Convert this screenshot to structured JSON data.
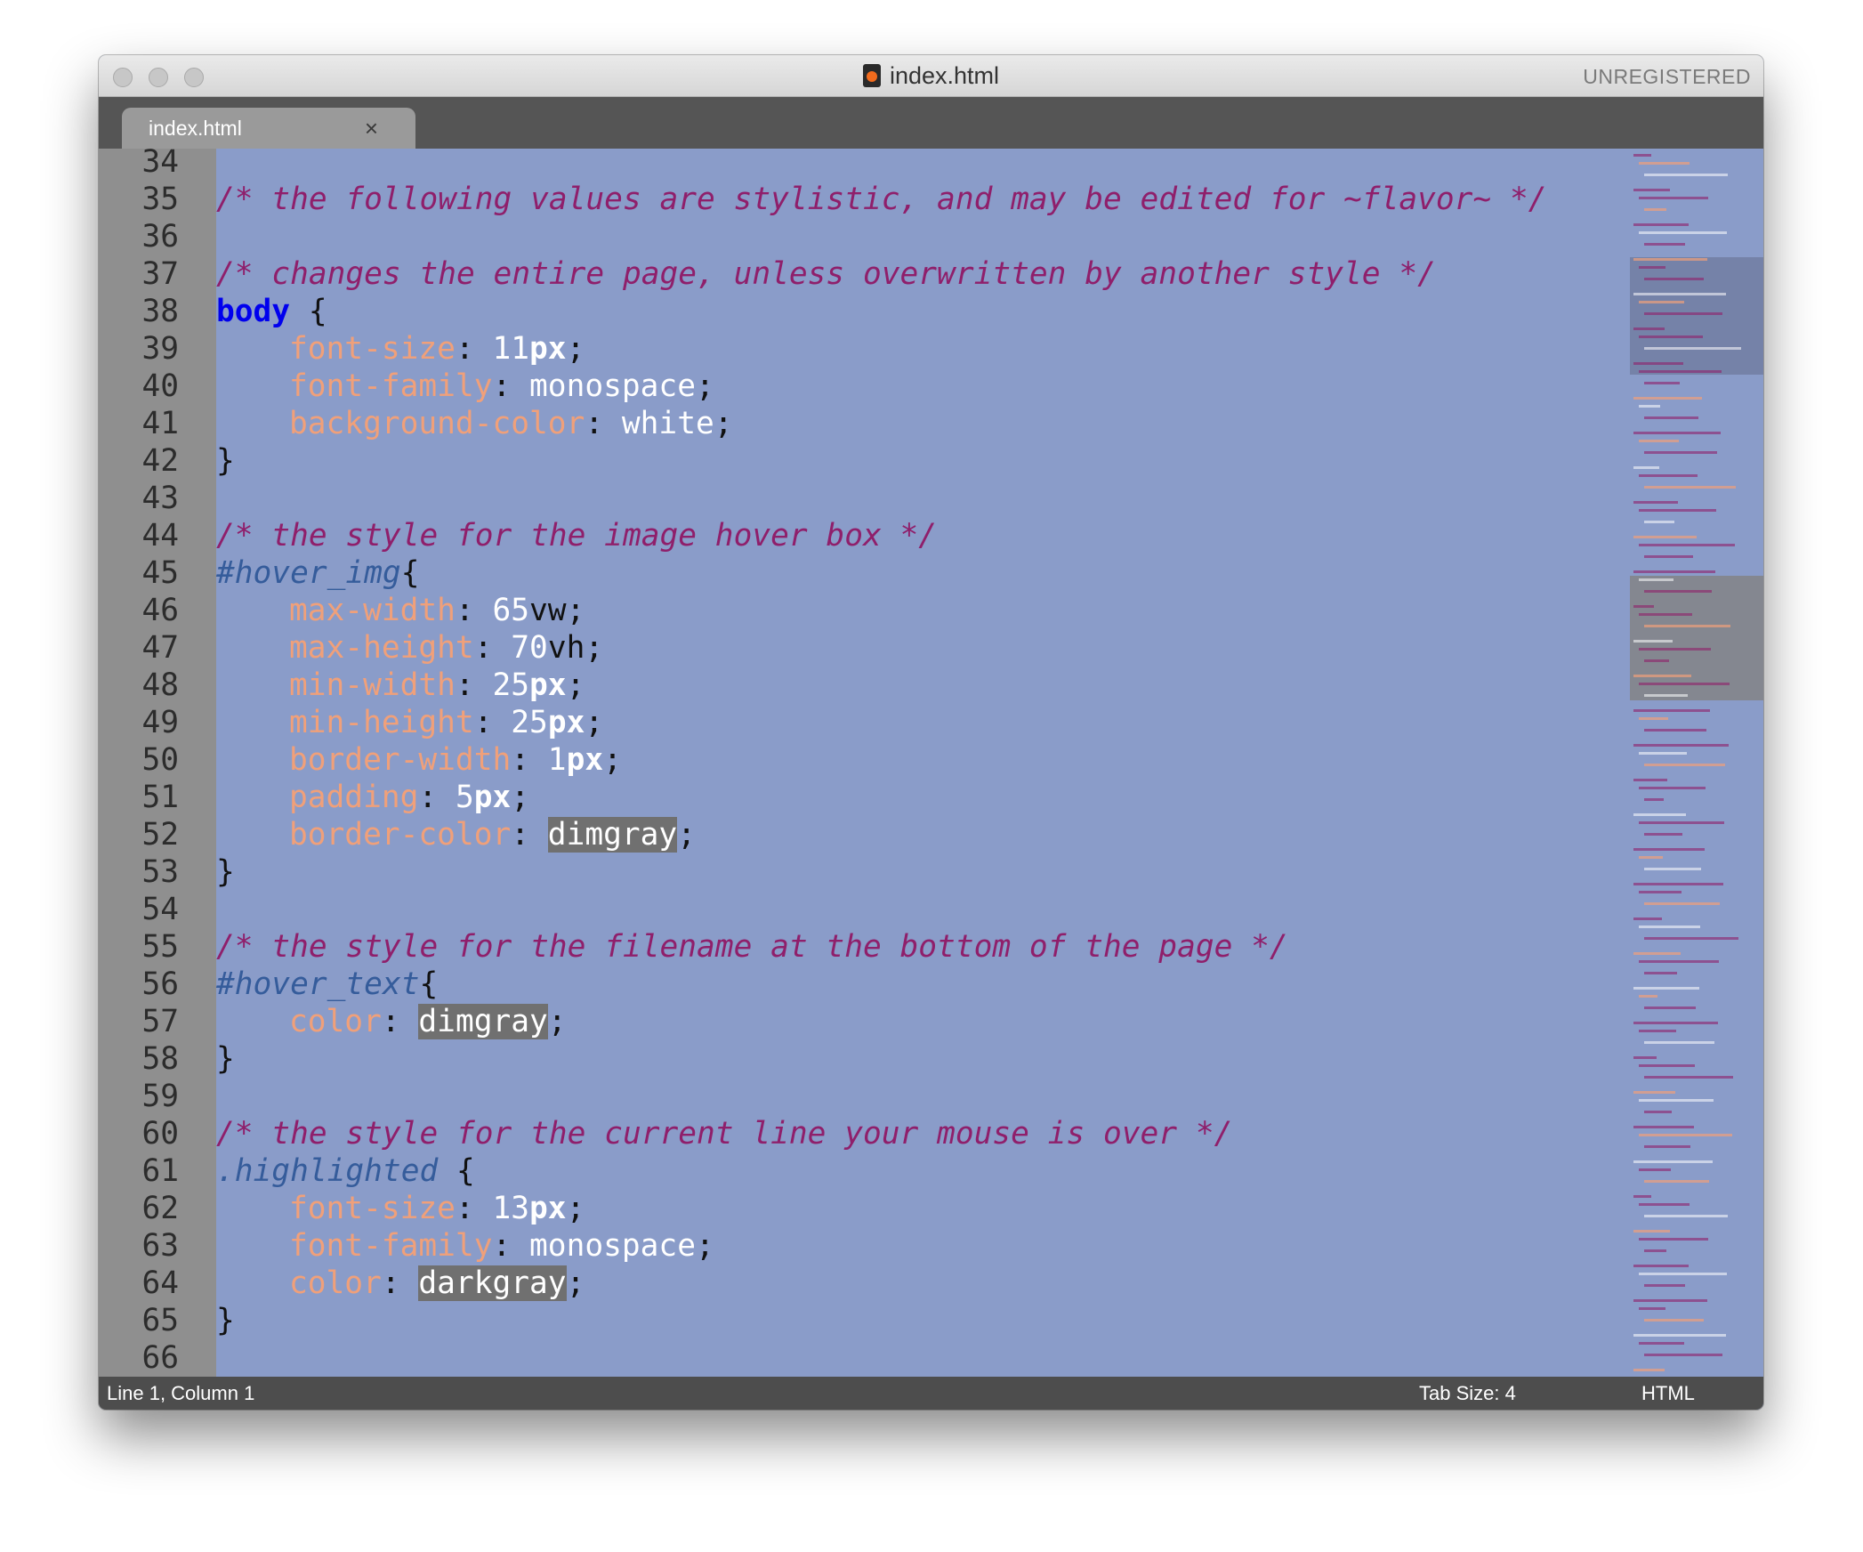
{
  "window": {
    "title": "index.html",
    "registration": "UNREGISTERED"
  },
  "tab": {
    "label": "index.html",
    "close": "×"
  },
  "code_lines": [
    {
      "n": "34"
    },
    {
      "n": "35",
      "comment": "/* the following values are stylistic, and may be edited for ~flavor~ */"
    },
    {
      "n": "36"
    },
    {
      "n": "37",
      "comment": "/* changes the entire page, unless overwritten by another style */"
    },
    {
      "n": "38",
      "selector": "body",
      "brace": " {"
    },
    {
      "n": "39",
      "prop": "font-size",
      "num": "11",
      "unit": "px"
    },
    {
      "n": "40",
      "prop": "font-family",
      "val": "monospace"
    },
    {
      "n": "41",
      "prop": "background-color",
      "val": "white"
    },
    {
      "n": "42",
      "close": "}"
    },
    {
      "n": "43"
    },
    {
      "n": "44",
      "comment": "/* the style for the image hover box */"
    },
    {
      "n": "45",
      "id": "#hover_img",
      "brace": "{"
    },
    {
      "n": "46",
      "prop": "max-width",
      "num": "65",
      "unitd": "vw"
    },
    {
      "n": "47",
      "prop": "max-height",
      "num": "70",
      "unitd": "vh"
    },
    {
      "n": "48",
      "prop": "min-width",
      "num": "25",
      "unit": "px"
    },
    {
      "n": "49",
      "prop": "min-height",
      "num": "25",
      "unit": "px"
    },
    {
      "n": "50",
      "prop": "border-width",
      "num": "1",
      "unit": "px"
    },
    {
      "n": "51",
      "prop": "padding",
      "num": "5",
      "unit": "px"
    },
    {
      "n": "52",
      "prop": "border-color",
      "hl": "dimgray"
    },
    {
      "n": "53",
      "close": "}"
    },
    {
      "n": "54"
    },
    {
      "n": "55",
      "comment": "/* the style for the filename at the bottom of the page */"
    },
    {
      "n": "56",
      "id": "#hover_text",
      "brace": "{"
    },
    {
      "n": "57",
      "prop": "color",
      "hl": "dimgray"
    },
    {
      "n": "58",
      "close": "}"
    },
    {
      "n": "59"
    },
    {
      "n": "60",
      "comment": "/* the style for the current line your mouse is over */"
    },
    {
      "n": "61",
      "id": ".highlighted",
      "brace": " {"
    },
    {
      "n": "62",
      "prop": "font-size",
      "num": "13",
      "unit": "px"
    },
    {
      "n": "63",
      "prop": "font-family",
      "val": "monospace"
    },
    {
      "n": "64",
      "prop": "color",
      "hl": "darkgray"
    },
    {
      "n": "65",
      "close": "}"
    },
    {
      "n": "66"
    }
  ],
  "status": {
    "position": "Line 1, Column 1",
    "tab_size": "Tab Size: 4",
    "syntax": "HTML"
  },
  "colors": {
    "editor_bg": "#8a9cc9",
    "comment": "#8f1f6b",
    "property": "#f0a07a",
    "selector": "#0000ee"
  }
}
